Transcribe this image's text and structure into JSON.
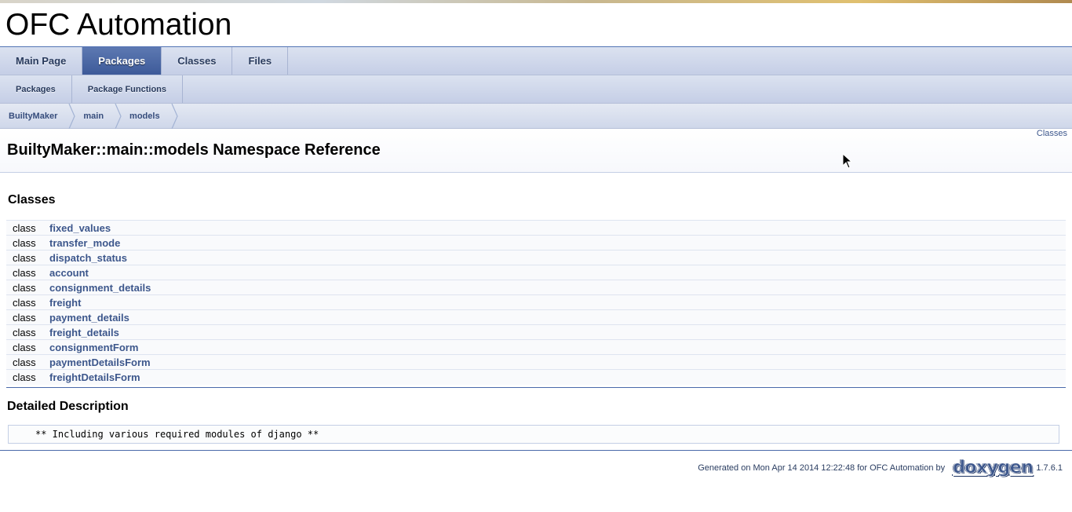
{
  "project": {
    "name": "OFC Automation"
  },
  "main_tabs": [
    {
      "label": "Main Page",
      "active": false
    },
    {
      "label": "Packages",
      "active": true
    },
    {
      "label": "Classes",
      "active": false
    },
    {
      "label": "Files",
      "active": false
    }
  ],
  "sub_tabs": [
    {
      "label": "Packages"
    },
    {
      "label": "Package Functions"
    }
  ],
  "breadcrumb": [
    "BuiltyMaker",
    "main",
    "models"
  ],
  "header": {
    "summary_link": "Classes",
    "title": "BuiltyMaker::main::models Namespace Reference"
  },
  "classes_section": {
    "heading": "Classes",
    "rows": [
      {
        "kind": "class",
        "name": "fixed_values"
      },
      {
        "kind": "class",
        "name": "transfer_mode"
      },
      {
        "kind": "class",
        "name": "dispatch_status"
      },
      {
        "kind": "class",
        "name": "account"
      },
      {
        "kind": "class",
        "name": "consignment_details"
      },
      {
        "kind": "class",
        "name": "freight"
      },
      {
        "kind": "class",
        "name": "payment_details"
      },
      {
        "kind": "class",
        "name": "freight_details"
      },
      {
        "kind": "class",
        "name": "consignmentForm"
      },
      {
        "kind": "class",
        "name": "paymentDetailsForm"
      },
      {
        "kind": "class",
        "name": "freightDetailsForm"
      }
    ]
  },
  "detailed": {
    "heading": "Detailed Description",
    "fragment": "** Including various required modules of django **"
  },
  "footer": {
    "generated_text": "Generated on Mon Apr 14 2014 12:22:48 for OFC Automation by",
    "logo_text": "doxygen",
    "version": "1.7.6.1"
  },
  "colors": {
    "link": "#3d578c",
    "tab_active": "#3d5a99",
    "rule": "#4a6aaa"
  }
}
